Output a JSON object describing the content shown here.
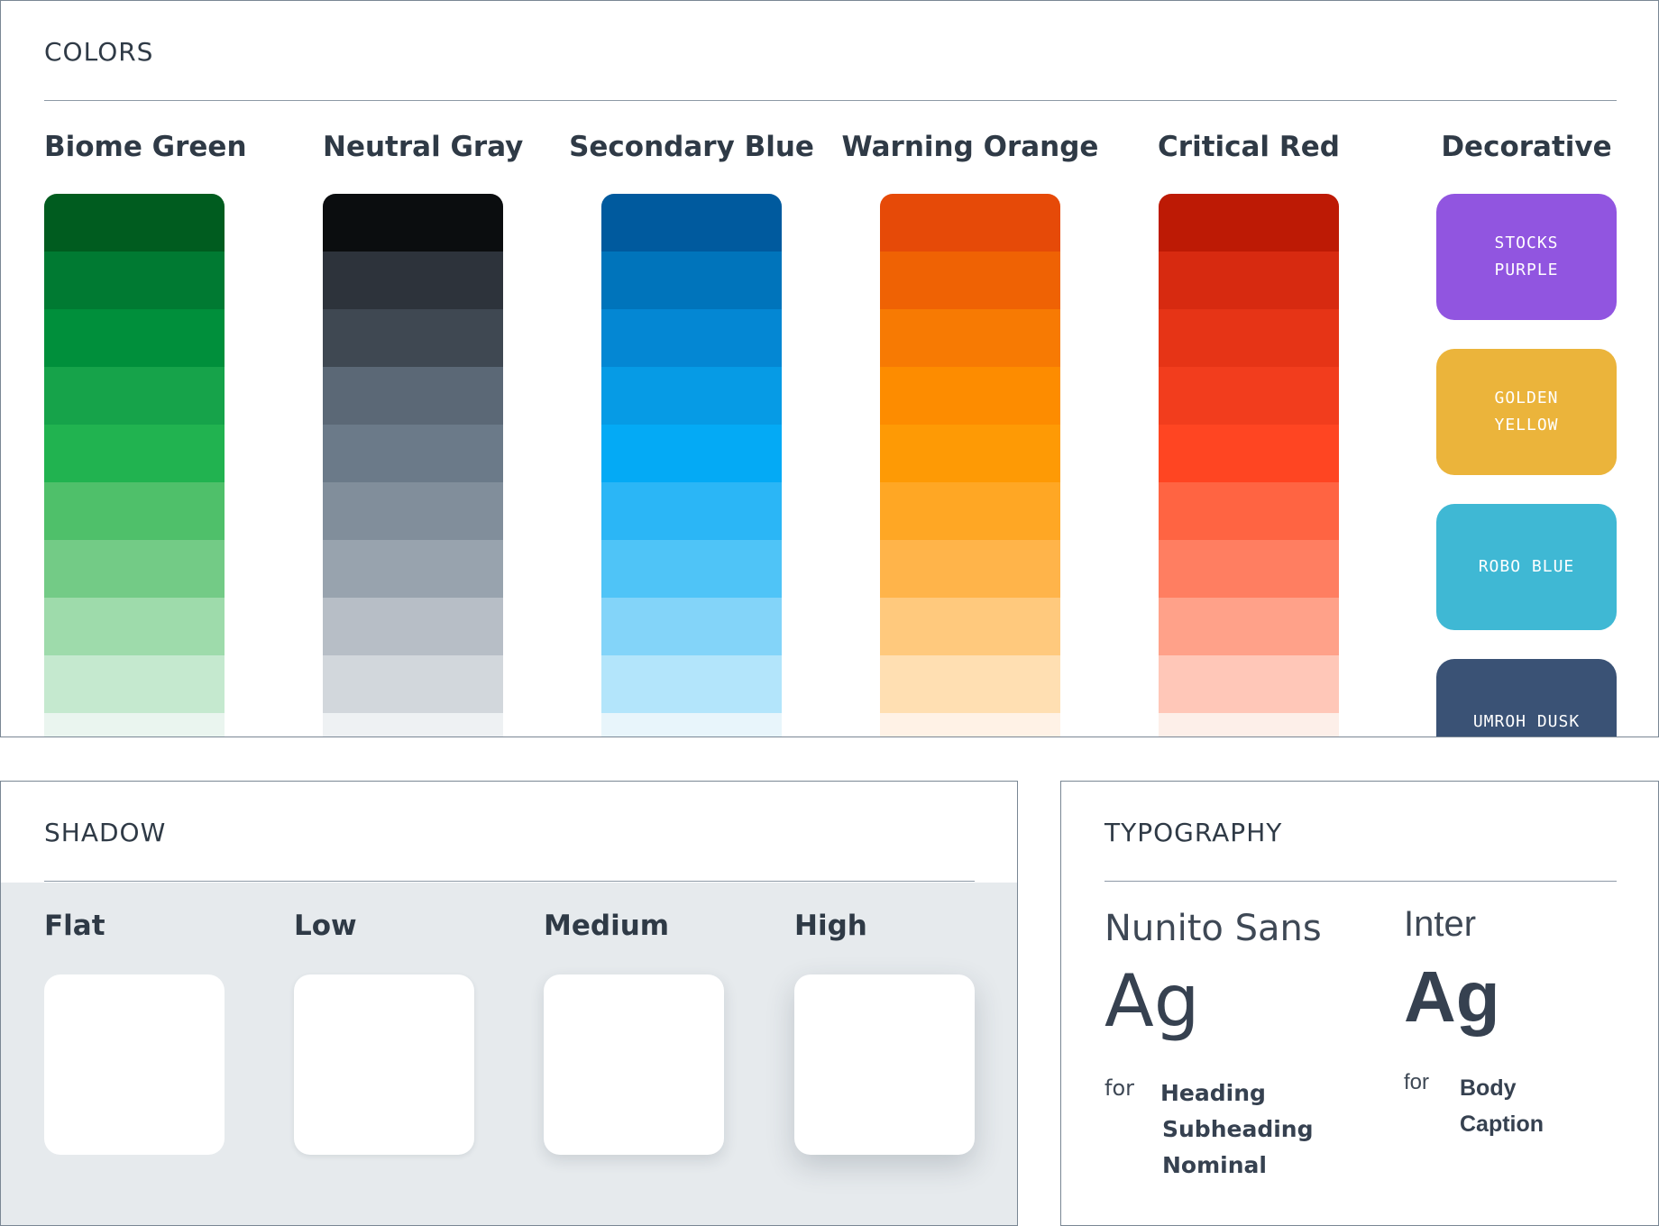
{
  "colors": {
    "title": "COLORS",
    "palettes": [
      {
        "name": "Biome Green",
        "swatches": [
          "#005c1f",
          "#007a32",
          "#008f3b",
          "#16a34a",
          "#21b350",
          "#4fc06a",
          "#73cb86",
          "#9edbab",
          "#c5e9cf",
          "#eaf5ef"
        ]
      },
      {
        "name": "Neutral Gray",
        "swatches": [
          "#0b0d0f",
          "#2d333b",
          "#3f4852",
          "#5b6876",
          "#6b7a89",
          "#818e9b",
          "#98a3ae",
          "#b7bec6",
          "#d2d7dc",
          "#eef1f3"
        ]
      },
      {
        "name": "Secondary Blue",
        "swatches": [
          "#005a9e",
          "#0074bb",
          "#0487d3",
          "#069be5",
          "#04aaf5",
          "#2bb6f6",
          "#4fc4f7",
          "#83d4f9",
          "#b3e5fb",
          "#e8f5fb"
        ]
      },
      {
        "name": "Warning Orange",
        "swatches": [
          "#e64a08",
          "#ef6204",
          "#f77a03",
          "#fd8c00",
          "#fe9a05",
          "#ffa724",
          "#ffb44a",
          "#ffc97d",
          "#ffdfb2",
          "#fff2e6"
        ]
      },
      {
        "name": "Critical Red",
        "swatches": [
          "#bd1a05",
          "#d72a10",
          "#e63416",
          "#f23d1d",
          "#ff4522",
          "#ff6442",
          "#ff7e61",
          "#ffa189",
          "#ffc7b8",
          "#fdefe9"
        ]
      }
    ],
    "decorative": {
      "name": "Decorative",
      "tiles": [
        {
          "label": "STOCKS PURPLE",
          "color": "#9155e0"
        },
        {
          "label": "GOLDEN YELLOW",
          "color": "#ebb43b"
        },
        {
          "label": "ROBO BLUE",
          "color": "#3fb8d4"
        },
        {
          "label": "UMROH DUSK",
          "color": "#3a5275"
        }
      ]
    }
  },
  "shadow": {
    "title": "SHADOW",
    "levels": [
      {
        "label": "Flat"
      },
      {
        "label": "Low"
      },
      {
        "label": "Medium"
      },
      {
        "label": "High"
      }
    ]
  },
  "typography": {
    "title": "TYPOGRAPHY",
    "fonts": [
      {
        "name": "Nunito Sans",
        "sample": "Ag",
        "for_label": "for",
        "uses": [
          "Heading",
          "Subheading",
          "Nominal"
        ]
      },
      {
        "name": "Inter",
        "sample": "Ag",
        "for_label": "for",
        "uses": [
          "Body",
          "Caption"
        ]
      }
    ]
  }
}
